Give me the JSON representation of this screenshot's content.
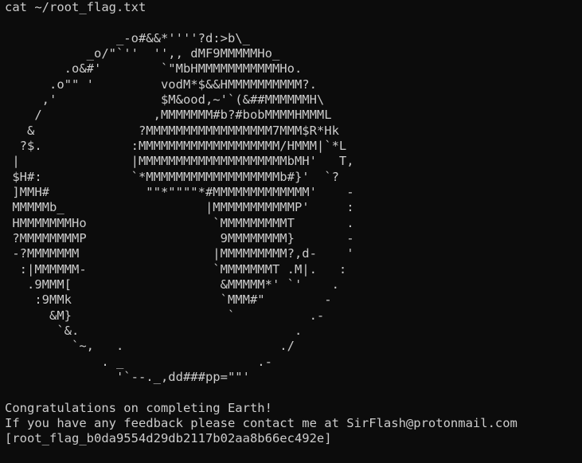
{
  "terminal": {
    "command": "cat ~/root_flag.txt",
    "ascii_art": [
      "",
      "               _-o#&&*''''?d:>b\\_",
      "           _o/\"`''  '',, dMF9MMMMMHo_",
      "        .o&#'        `\"MbHMMMMMMMMMMMHo.",
      "      .o\"\" '         vodM*$&&HMMMMMMMMMM?.",
      "     ,'              $M&ood,~'`(&##MMMMMMH\\",
      "    /               ,MMMMMMM#b?#bobMMMMHMMML",
      "   &              ?MMMMMMMMMMMMMMMMM7MMM$R*Hk",
      "  ?$.            :MMMMMMMMMMMMMMMMMMM/HMMM|`*L",
      " |               |MMMMMMMMMMMMMMMMMMMMbMH'   T,",
      " $H#:            `*MMMMMMMMMMMMMMMMMMb#}'  `?",
      " ]MMH#             \"\"*\"\"\"\"*#MMMMMMMMMMMMM'    -",
      " MMMMMb_                   |MMMMMMMMMMMP'     :",
      " HMMMMMMMHo                 `MMMMMMMMMT       .",
      " ?MMMMMMMMP                  9MMMMMMMM}       -",
      " -?MMMMMMM                  |MMMMMMMMM?,d-    '",
      "  :|MMMMMM-                 `MMMMMMMT .M|.   :",
      "   .9MMM[                    &MMMMM*' `'    .",
      "    :9MMk                    `MMM#\"        -",
      "      &M}                     `          .-",
      "       `&.                             .",
      "         `~,   .                     ./",
      "             . _                  .-",
      "               '`--._,dd###pp=\"\"'",
      ""
    ],
    "message_line_1": "Congratulations on completing Earth!",
    "message_line_2": "If you have any feedback please contact me at SirFlash@protonmail.com",
    "flag": "[root_flag_b0da9554d29db2117b02aa8b66ec492e]"
  }
}
